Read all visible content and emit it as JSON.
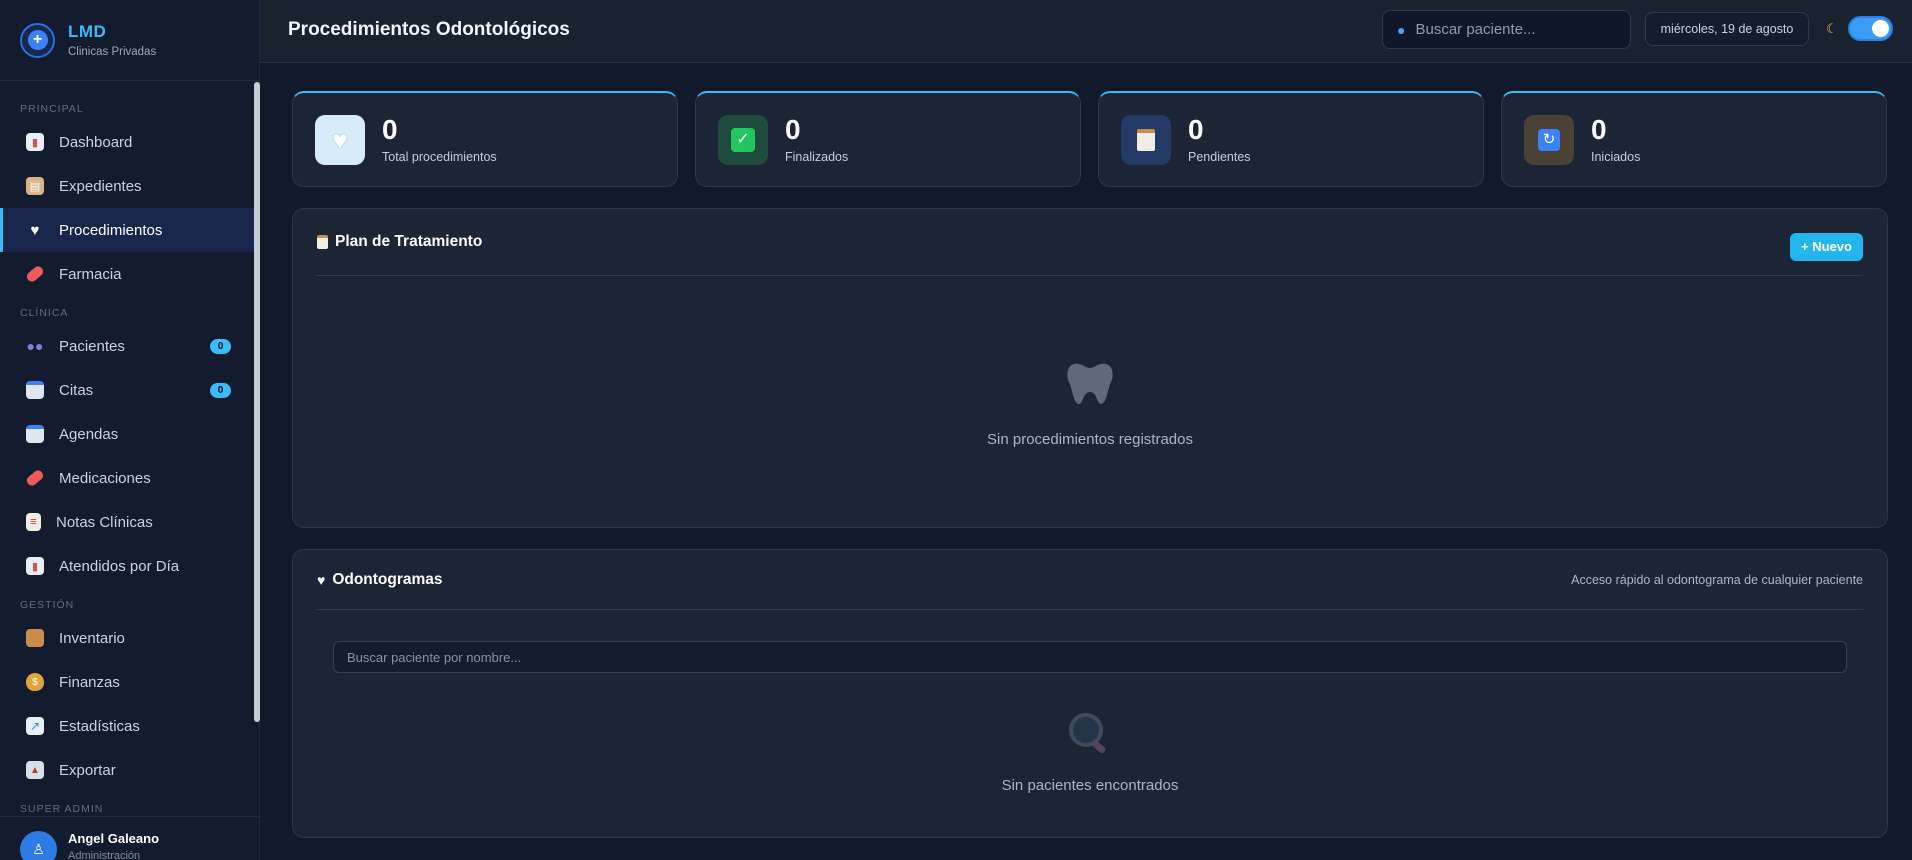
{
  "brand": {
    "title": "LMD",
    "subtitle": "Clinicas Privadas"
  },
  "sidebar": {
    "sections": [
      {
        "label": "PRINCIPAL"
      },
      {
        "label": "CLÍNICA"
      },
      {
        "label": "GESTIÓN"
      },
      {
        "label": "SUPER ADMIN"
      }
    ],
    "items": [
      {
        "label": "Dashboard",
        "icon": "chart-icon"
      },
      {
        "label": "Expedientes",
        "icon": "clipboard-icon"
      },
      {
        "label": "Procedimientos",
        "icon": "tooth-icon",
        "active": true
      },
      {
        "label": "Farmacia",
        "icon": "pill-icon"
      },
      {
        "label": "Pacientes",
        "icon": "people-icon",
        "badge": "0"
      },
      {
        "label": "Citas",
        "icon": "calendar-icon",
        "badge": "0"
      },
      {
        "label": "Agendas",
        "icon": "calendar-icon"
      },
      {
        "label": "Medicaciones",
        "icon": "pill-icon"
      },
      {
        "label": "Notas Clínicas",
        "icon": "note-icon"
      },
      {
        "label": "Atendidos por Día",
        "icon": "chart-icon"
      },
      {
        "label": "Inventario",
        "icon": "box-icon"
      },
      {
        "label": "Finanzas",
        "icon": "moneybag-icon"
      },
      {
        "label": "Estadísticas",
        "icon": "trend-icon"
      },
      {
        "label": "Exportar",
        "icon": "export-icon"
      }
    ]
  },
  "user": {
    "name": "Angel Galeano",
    "role": "Administración"
  },
  "header": {
    "title": "Procedimientos Odontológicos",
    "search_placeholder": "Buscar paciente...",
    "date": "miércoles, 19 de agosto"
  },
  "stats": [
    {
      "value": "0",
      "label": "Total procedimientos",
      "icon": "tooth-icon",
      "color": "#d6ecfb"
    },
    {
      "value": "0",
      "label": "Finalizados",
      "icon": "check-icon",
      "color": "#1f4a3e"
    },
    {
      "value": "0",
      "label": "Pendientes",
      "icon": "clipboard-icon",
      "color": "#243a66"
    },
    {
      "value": "0",
      "label": "Iniciados",
      "icon": "refresh-icon",
      "color": "#4a4236"
    }
  ],
  "plan": {
    "title": "Plan de Tratamiento",
    "new_button": "+ Nuevo",
    "empty_text": "Sin procedimientos registrados"
  },
  "odontogramas": {
    "title": "Odontogramas",
    "hint": "Acceso rápido al odontograma de cualquier paciente",
    "search_placeholder": "Buscar paciente por nombre...",
    "empty_text": "Sin pacientes encontrados"
  },
  "colors": {
    "accent": "#38bdf8",
    "active_bg": "#17264a",
    "background": "#111a2b",
    "card": "#1c2536"
  }
}
